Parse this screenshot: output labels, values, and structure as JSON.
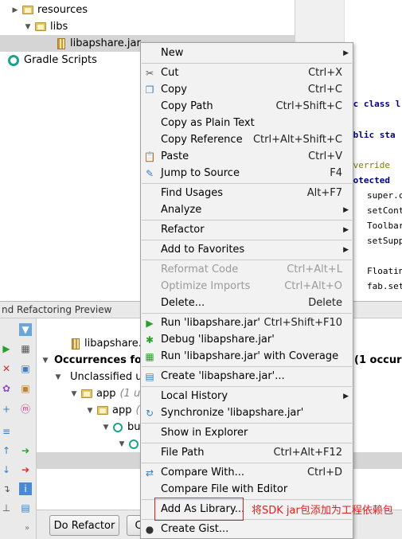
{
  "tree": {
    "items": [
      {
        "label": "resources"
      },
      {
        "label": "libs"
      },
      {
        "label": "libapshare.jar"
      },
      {
        "label": "Gradle Scripts"
      }
    ]
  },
  "editor": {
    "lines": [
      "ic class l",
      "ublic sta",
      "Override",
      "rotected",
      "super.c",
      "setConte",
      "Toolbar",
      "setSuppo",
      "Floating",
      "fab.setC"
    ]
  },
  "panel": {
    "title": "nd Refactoring Preview",
    "results": {
      "jar_label": "libapshare.ja",
      "occurrences_label": "Occurrences foun",
      "occurrences_tail": "(1 occurre",
      "unclassified": "Unclassified us",
      "app1": "app",
      "app1_hint": "(1 u",
      "app2": "app",
      "app2_hint": "(",
      "build_label": "bu"
    },
    "buttons": {
      "do_refactor": "Do Refactor",
      "cancel_stub": "C"
    }
  },
  "menu": {
    "items": [
      {
        "label": "New",
        "shortcut": "",
        "submenu": true
      },
      {
        "label": "Cut",
        "shortcut": "Ctrl+X",
        "icon": "scissors-icon"
      },
      {
        "label": "Copy",
        "shortcut": "Ctrl+C",
        "icon": "copy-icon"
      },
      {
        "label": "Copy Path",
        "shortcut": "Ctrl+Shift+C"
      },
      {
        "label": "Copy as Plain Text",
        "shortcut": ""
      },
      {
        "label": "Copy Reference",
        "shortcut": "Ctrl+Alt+Shift+C"
      },
      {
        "label": "Paste",
        "shortcut": "Ctrl+V",
        "icon": "paste-icon"
      },
      {
        "label": "Jump to Source",
        "shortcut": "F4",
        "icon": "jump-icon"
      },
      {
        "label": "Find Usages",
        "shortcut": "Alt+F7"
      },
      {
        "label": "Analyze",
        "shortcut": "",
        "submenu": true
      },
      {
        "label": "Refactor",
        "shortcut": "",
        "submenu": true
      },
      {
        "label": "Add to Favorites",
        "shortcut": "",
        "submenu": true
      },
      {
        "label": "Reformat Code",
        "shortcut": "Ctrl+Alt+L",
        "disabled": true
      },
      {
        "label": "Optimize Imports",
        "shortcut": "Ctrl+Alt+O",
        "disabled": true
      },
      {
        "label": "Delete...",
        "shortcut": "Delete"
      },
      {
        "label": "Run 'libapshare.jar'",
        "shortcut": "Ctrl+Shift+F10",
        "icon": "run-icon"
      },
      {
        "label": "Debug 'libapshare.jar'",
        "shortcut": "",
        "icon": "debug-icon"
      },
      {
        "label": "Run 'libapshare.jar' with Coverage",
        "shortcut": "",
        "icon": "coverage-icon"
      },
      {
        "label": "Create 'libapshare.jar'...",
        "shortcut": "",
        "icon": "create-config-icon"
      },
      {
        "label": "Local History",
        "shortcut": "",
        "submenu": true
      },
      {
        "label": "Synchronize 'libapshare.jar'",
        "shortcut": "",
        "icon": "sync-icon"
      },
      {
        "label": "Show in Explorer",
        "shortcut": ""
      },
      {
        "label": "File Path",
        "shortcut": "Ctrl+Alt+F12"
      },
      {
        "label": "Compare With...",
        "shortcut": "Ctrl+D",
        "icon": "compare-icon"
      },
      {
        "label": "Compare File with Editor",
        "shortcut": ""
      },
      {
        "label": "Add As Library...",
        "shortcut": ""
      },
      {
        "label": "Create Gist...",
        "shortcut": "",
        "icon": "github-icon"
      }
    ]
  },
  "annotation": {
    "text": "将SDK jar包添加为工程依赖包",
    "color": "#e02020"
  }
}
